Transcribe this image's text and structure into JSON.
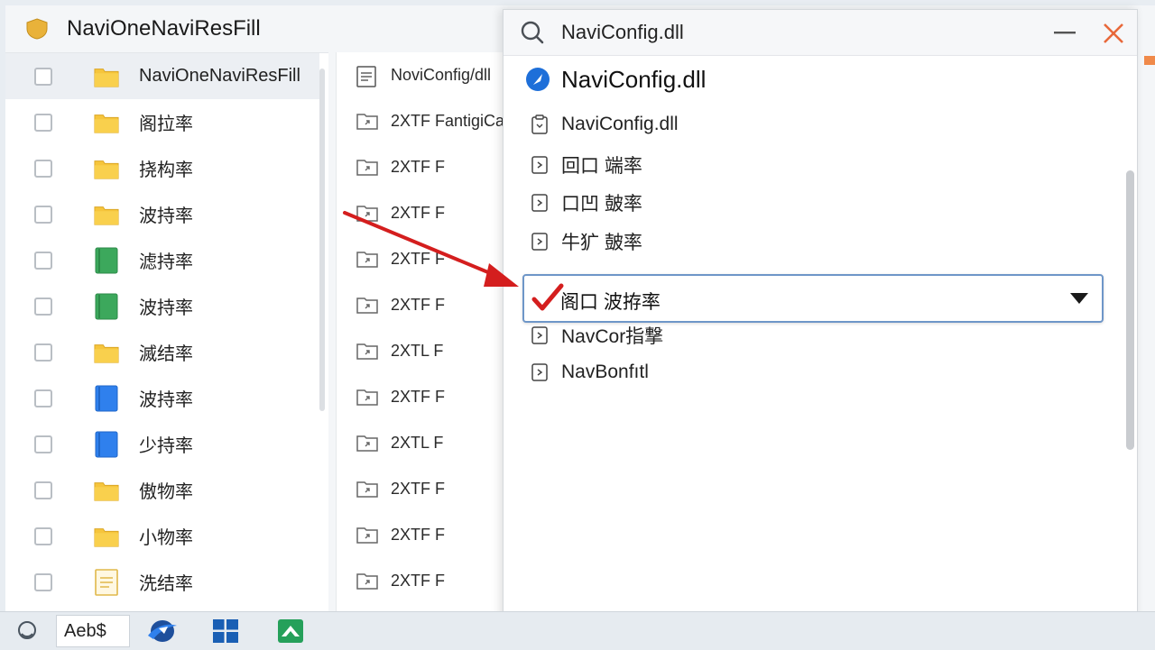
{
  "window": {
    "title": "NaviOneNaviResFill"
  },
  "left_list": {
    "rows": [
      {
        "label": "NaviOneNaviResFill",
        "icon": "folder-yellow"
      },
      {
        "label": "阁拉率",
        "icon": "folder-yellow"
      },
      {
        "label": "挠构率",
        "icon": "folder-yellow"
      },
      {
        "label": "波持率",
        "icon": "folder-yellow"
      },
      {
        "label": "滤持率",
        "icon": "book-green"
      },
      {
        "label": "波持率",
        "icon": "book-green"
      },
      {
        "label": "滅结率",
        "icon": "folder-yellow"
      },
      {
        "label": "波持率",
        "icon": "book-blue"
      },
      {
        "label": "少持率",
        "icon": "book-blue"
      },
      {
        "label": "傲物率",
        "icon": "folder-yellow"
      },
      {
        "label": "小物率",
        "icon": "folder-yellow"
      },
      {
        "label": "洗结率",
        "icon": "document-yellow"
      }
    ]
  },
  "middle_list": {
    "rows": [
      {
        "label": "NoviConfig/dll",
        "icon": "document-icon"
      },
      {
        "label": "2XTF FantigiCa",
        "icon": "file-link-icon"
      },
      {
        "label": "2XTF F",
        "icon": "file-link-icon"
      },
      {
        "label": "2XTF F",
        "icon": "file-link-icon"
      },
      {
        "label": "2XTF F",
        "icon": "file-link-icon"
      },
      {
        "label": "2XTF F",
        "icon": "file-link-icon"
      },
      {
        "label": "2XTL F",
        "icon": "file-link-icon"
      },
      {
        "label": "2XTF F",
        "icon": "file-link-icon"
      },
      {
        "label": "2XTL F",
        "icon": "file-link-icon"
      },
      {
        "label": "2XTF F",
        "icon": "file-link-icon"
      },
      {
        "label": "2XTF F",
        "icon": "file-link-icon"
      },
      {
        "label": "2XTF F",
        "icon": "file-link-icon"
      }
    ]
  },
  "search_panel": {
    "query": "NaviConfig.dll",
    "header": "NaviConfig.dll",
    "results": [
      "NaviConfig.dll",
      "回口  端率",
      "口凹  皷率",
      "牛犷  皷率"
    ],
    "dropdown_value": "阁口  波拵率",
    "more_results": [
      "NavCor指撃",
      "NavBonfıtl"
    ]
  },
  "taskbar": {
    "input_value": "Aeb$",
    "apps": [
      "search-icon",
      "browser-icon",
      "windows-icon",
      "store-icon"
    ]
  },
  "colors": {
    "accent_blue": "#1e6fd9",
    "annotation_red": "#d41e1e",
    "close_orange": "#e8683a",
    "folder_yellow": "#f6c53c",
    "book_green": "#3ca85c",
    "book_blue": "#2f80ed"
  }
}
